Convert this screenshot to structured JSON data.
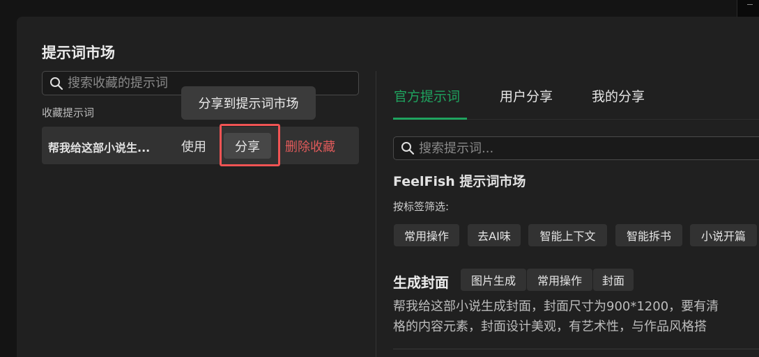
{
  "dialog": {
    "title": "提示词市场"
  },
  "left_panel": {
    "search_placeholder": "搜索收藏的提示词",
    "section_label": "收藏提示词",
    "favorites": [
      {
        "title": "帮我给这部小说生...",
        "use_label": "使用",
        "share_label": "分享",
        "remove_label": "删除收藏"
      }
    ],
    "tooltip": "分享到提示词市场"
  },
  "right_panel": {
    "tabs": [
      {
        "label": "官方提示词",
        "active": true
      },
      {
        "label": "用户分享",
        "active": false
      },
      {
        "label": "我的分享",
        "active": false
      }
    ],
    "search_placeholder": "搜索提示词...",
    "market_title": "FeelFish 提示词市场",
    "filter_label": "按标签筛选:",
    "filter_tags": [
      "常用操作",
      "去AI味",
      "智能上下文",
      "智能拆书",
      "小说开篇"
    ],
    "items": [
      {
        "title": "生成封面",
        "tags": [
          "图片生成",
          "常用操作",
          "封面"
        ],
        "description_lines": [
          "帮我给这部小说生成封面，封面尺寸为900*1200，要有清",
          "格的内容元素，封面设计美观，有艺术性，与作品风格搭"
        ]
      }
    ]
  },
  "colors": {
    "accent": "#1fa45f",
    "danger": "#e05a5a",
    "highlight_box": "#f05454",
    "background": "#202020"
  },
  "icons": {
    "search": "search-icon"
  }
}
